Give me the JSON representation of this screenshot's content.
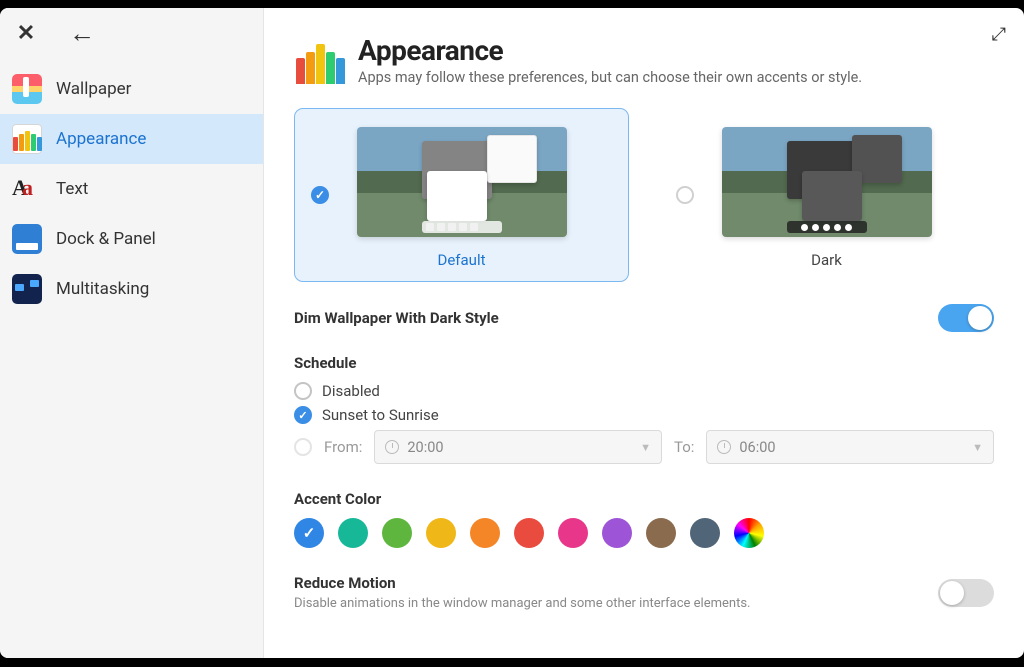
{
  "sidebar": {
    "items": [
      {
        "label": "Wallpaper"
      },
      {
        "label": "Appearance"
      },
      {
        "label": "Text"
      },
      {
        "label": "Dock & Panel"
      },
      {
        "label": "Multitasking"
      }
    ],
    "selected_index": 1
  },
  "header": {
    "title": "Appearance",
    "subtitle": "Apps may follow these preferences, but can choose their own accents or style."
  },
  "themes": {
    "options": [
      {
        "label": "Default"
      },
      {
        "label": "Dark"
      }
    ],
    "selected_index": 0
  },
  "dim_wallpaper": {
    "label": "Dim Wallpaper With Dark Style",
    "enabled": true
  },
  "schedule": {
    "title": "Schedule",
    "options": {
      "disabled_label": "Disabled",
      "sunset_label": "Sunset to Sunrise",
      "manual_from_label": "From:",
      "manual_to_label": "To:"
    },
    "selected": "sunset",
    "from_time": "20:00",
    "to_time": "06:00"
  },
  "accent": {
    "title": "Accent Color",
    "colors": [
      "#2f86e4",
      "#17b898",
      "#5fb63f",
      "#f0b719",
      "#f48628",
      "#ea4b3f",
      "#e8368b",
      "#9d54d6",
      "#8a6b4e",
      "#516578",
      "rainbow"
    ],
    "selected_index": 0
  },
  "reduce_motion": {
    "title": "Reduce Motion",
    "subtitle": "Disable animations in the window manager and some other interface elements.",
    "enabled": false
  }
}
